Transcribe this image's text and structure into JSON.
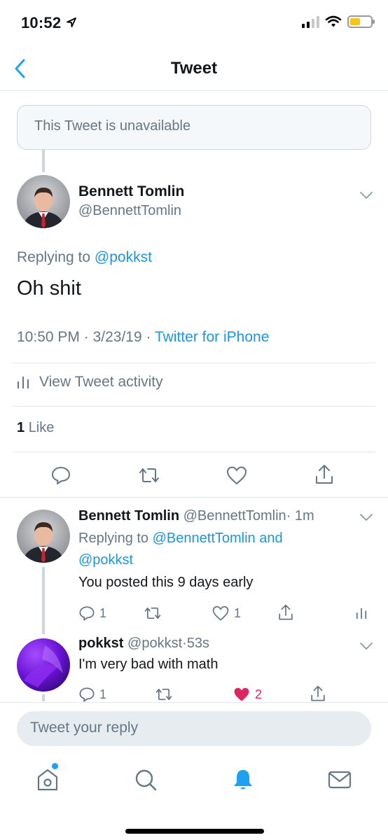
{
  "status_bar": {
    "time": "10:52"
  },
  "nav": {
    "title": "Tweet"
  },
  "unavailable_notice": "This Tweet is unavailable",
  "main_tweet": {
    "name": "Bennett Tomlin",
    "handle": "@BennettTomlin",
    "replying_prefix": "Replying to",
    "replying_to": "@pokkst",
    "text": "Oh shit",
    "time": "10:50 PM",
    "sep1": "·",
    "date": "3/23/19",
    "sep2": "·",
    "source": "Twitter for iPhone",
    "activity_label": "View Tweet activity",
    "like_count": "1",
    "like_label": "Like"
  },
  "replies": [
    {
      "name": "Bennett Tomlin",
      "handle": "@BennettTomlin",
      "sep": "·",
      "age": "1m",
      "replying_prefix": "Replying to",
      "replying_to": "@BennettTomlin and @pokkst",
      "text": "You posted this 9 days early",
      "reply_count": "1",
      "like_count": "1"
    },
    {
      "name": "pokkst",
      "handle": "@pokkst",
      "sep": "·",
      "age": "53s",
      "text": "I'm very bad with math",
      "reply_count": "1",
      "like_count": "2"
    }
  ],
  "composer": {
    "placeholder": "Tweet your reply"
  },
  "tabs": [
    "home-icon",
    "search-icon",
    "notifications-icon",
    "messages-icon"
  ],
  "colors": {
    "accent": "#1da1f2",
    "link": "#1b95e0",
    "muted": "#657786",
    "like": "#e0245e",
    "battery": "#f5c518"
  }
}
